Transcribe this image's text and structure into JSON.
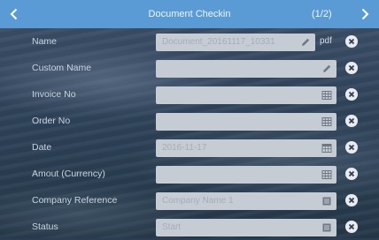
{
  "header": {
    "title": "Document Checkin",
    "page_indicator": "(1/2)",
    "color": "#5b9bd5"
  },
  "fields": [
    {
      "label": "Name",
      "value": "Document_20161117_10331",
      "action_icon": "pencil-icon",
      "suffix": "pdf"
    },
    {
      "label": "Custom Name",
      "value": "",
      "action_icon": "pencil-icon"
    },
    {
      "label": "Invoice No",
      "value": "",
      "action_icon": "keypad-icon"
    },
    {
      "label": "Order No",
      "value": "",
      "action_icon": "keypad-icon"
    },
    {
      "label": "Date",
      "value": "2016-11-17",
      "action_icon": "calendar-icon"
    },
    {
      "label": "Amout (Currency)",
      "value": "",
      "action_icon": "keypad-icon"
    },
    {
      "label": "Company Reference",
      "value": "Company Name 1",
      "action_icon": "list-icon"
    },
    {
      "label": "Status",
      "value": "Start",
      "action_icon": "list-icon"
    }
  ],
  "icons": {
    "prev": "chevron-left-icon",
    "next": "chevron-right-icon",
    "clear": "clear-circle-icon"
  }
}
